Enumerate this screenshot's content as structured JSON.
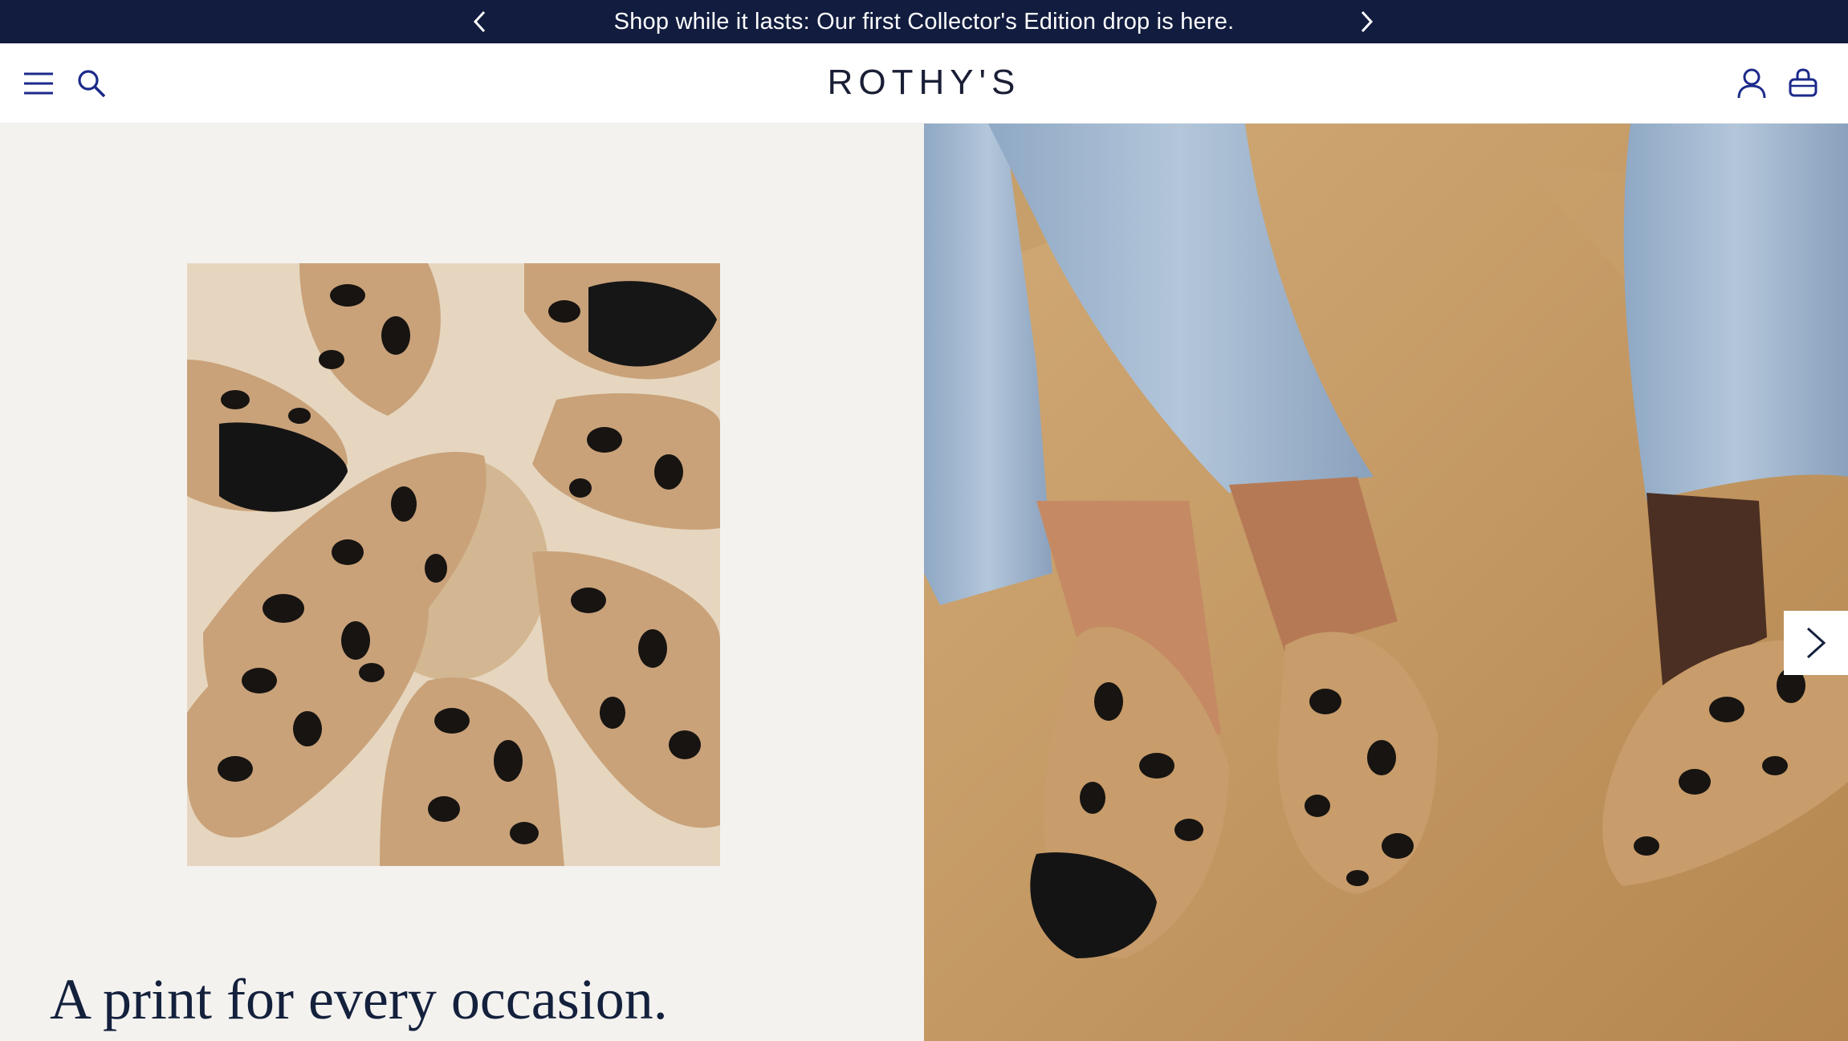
{
  "announcement": {
    "text": "Shop while it lasts: Our first Collector's Edition drop is here.",
    "prev_icon": "chevron-left-icon",
    "next_icon": "chevron-right-icon"
  },
  "header": {
    "logo": "ROTHY'S",
    "left_icons": [
      "hamburger-menu-icon",
      "search-icon"
    ],
    "right_icons": [
      "account-icon",
      "shopping-bag-icon"
    ]
  },
  "hero": {
    "headline": "A print for every occasion.",
    "left_image": "leopard-print-flats-flatlay",
    "right_image": "model-wearing-leopard-flats-on-rocks",
    "carousel_next_icon": "chevron-right-icon"
  },
  "colors": {
    "announcement_bg": "#121c3f",
    "brand_navy": "#14213d",
    "left_panel_bg": "#f4f2ef"
  }
}
